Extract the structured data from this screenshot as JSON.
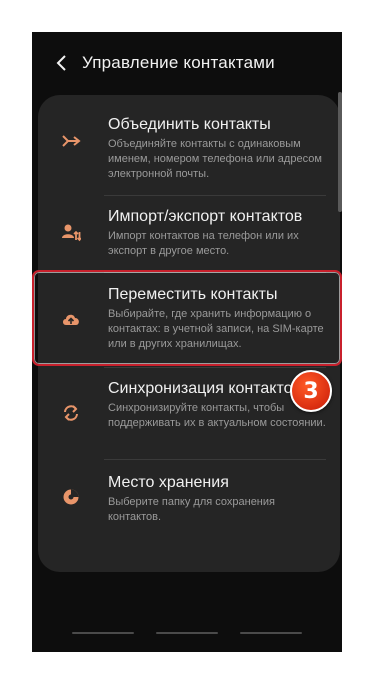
{
  "header": {
    "title": "Управление контактами"
  },
  "items": [
    {
      "title": "Объединить контакты",
      "description": "Объединяйте контакты с одинаковым именем, номером телефона или адресом электронной почты.",
      "icon": "merge-icon"
    },
    {
      "title": "Импорт/экспорт контактов",
      "description": "Импорт контактов на телефон или их экспорт в другое место.",
      "icon": "import-export-icon"
    },
    {
      "title": "Переместить контакты",
      "description": "Выбирайте, где хранить информацию о контактах: в учетной записи, на SIM-карте или в других хранилищах.",
      "icon": "cloud-upload-icon"
    },
    {
      "title": "Синхронизация контактов",
      "description": "Синхронизируйте контакты, чтобы поддерживать их в актуальном состоянии.",
      "icon": "sync-icon"
    },
    {
      "title": "Место хранения",
      "description": "Выберите папку для сохранения контактов.",
      "icon": "storage-icon"
    }
  ],
  "annotation": {
    "badge_number": "3"
  },
  "colors": {
    "accent": "#e8956a",
    "highlight": "#c8202c",
    "badge": "#e0361a"
  }
}
